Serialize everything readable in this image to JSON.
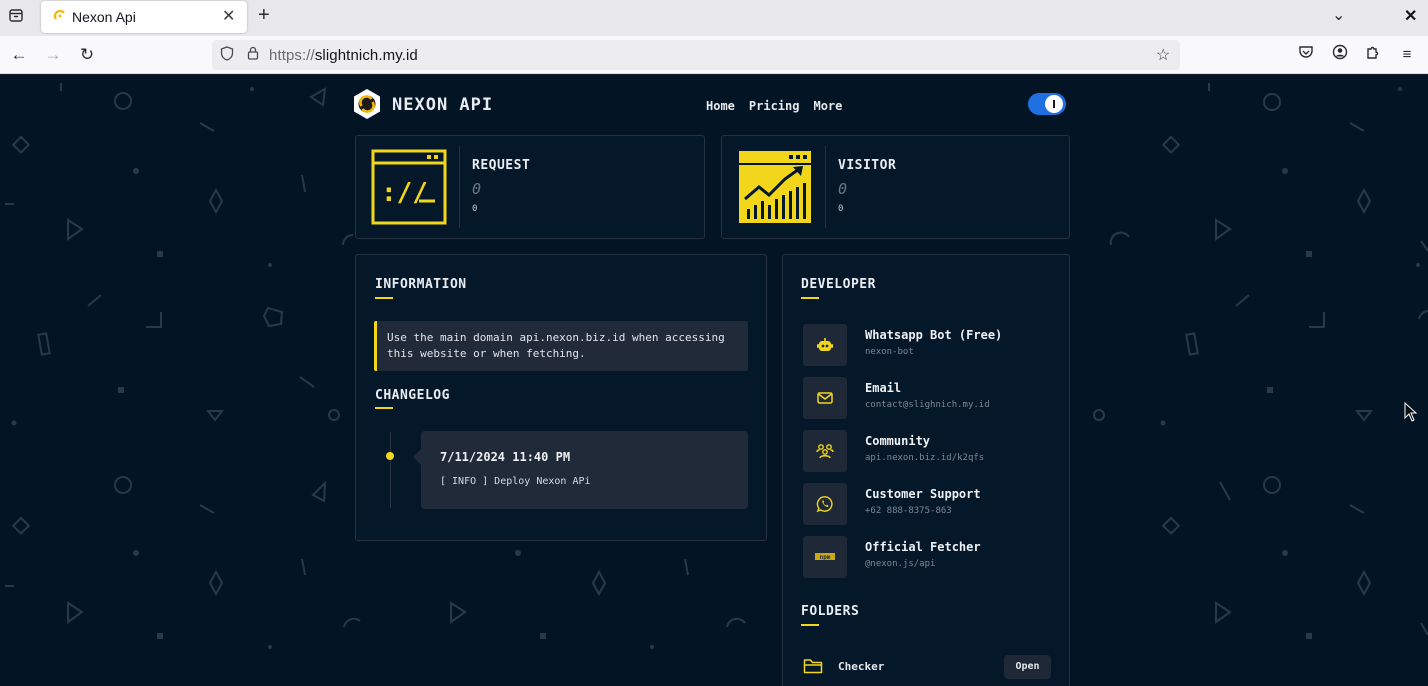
{
  "browser": {
    "tab_title": "Nexon Api",
    "url_scheme": "https://",
    "url_host": "slightnich.my.id",
    "icons": [
      "tab-list-icon",
      "close-icon",
      "new-tab-icon",
      "chevron-down-icon",
      "back-icon",
      "forward-icon",
      "reload-icon",
      "shield-icon",
      "lock-icon",
      "star-icon",
      "pocket-icon",
      "account-icon",
      "extensions-icon",
      "menu-icon"
    ]
  },
  "site": {
    "brand": "NEXON API",
    "nav": [
      "Home",
      "Pricing",
      "More"
    ],
    "theme_toggle_on": true,
    "accent_color": "#f2d61c"
  },
  "stats": [
    {
      "label": "REQUEST",
      "value": "0",
      "sub": "0",
      "icon": "terminal-window-icon"
    },
    {
      "label": "VISITOR",
      "value": "0",
      "sub": "0",
      "icon": "growth-chart-icon"
    }
  ],
  "information": {
    "title": "INFORMATION",
    "notice": "Use the main domain api.nexon.biz.id when accessing this website or when fetching."
  },
  "changelog": {
    "title": "CHANGELOG",
    "entries": [
      {
        "date": "7/11/2024 11:40 PM",
        "text": "[ INFO ] Deploy Nexon APi"
      }
    ]
  },
  "developer": {
    "title": "DEVELOPER",
    "items": [
      {
        "name": "Whatsapp Bot (Free)",
        "sub": "nexon-bot",
        "icon": "robot-icon"
      },
      {
        "name": "Email",
        "sub": "contact@slighnich.my.id",
        "icon": "mail-icon"
      },
      {
        "name": "Community",
        "sub": "api.nexon.biz.id/k2qfs",
        "icon": "community-icon"
      },
      {
        "name": "Customer Support",
        "sub": "+62 888-8375-863",
        "icon": "whatsapp-icon"
      },
      {
        "name": "Official Fetcher",
        "sub": "@nexon.js/api",
        "icon": "npm-icon"
      }
    ]
  },
  "folders": {
    "title": "FOLDERS",
    "items": [
      {
        "name": "Checker",
        "action": "Open",
        "icon": "folder-icon"
      }
    ]
  }
}
